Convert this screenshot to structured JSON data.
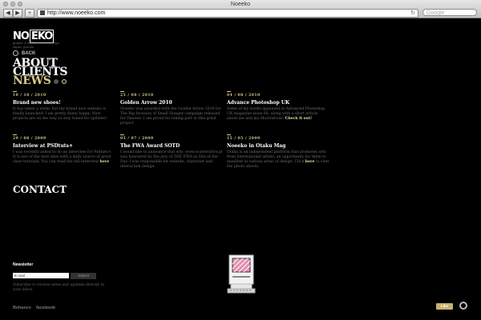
{
  "browser": {
    "window_title": "Noeeko",
    "url": "http://www.noeeko.com",
    "search_placeholder": "Google",
    "back_glyph": "◀",
    "forward_glyph": "▶",
    "add_glyph": "+",
    "reload_glyph": "↻"
  },
  "logo": {
    "text_a": "NO",
    "text_b": "EKO",
    "subtitle": "graphic & web interaction design studio, poznan"
  },
  "nav": {
    "back_label": "BACK",
    "about": "ABOUT",
    "clients": "CLIENTS",
    "news": "NEWS",
    "contact": "CONTACT"
  },
  "posts": [
    {
      "date": "10 / 10 / 2010",
      "title": "Brand new shoes!",
      "body": "It has taken a while, but my brand new website is finally launched! I am pretty damn happy. New projects are on the way so stay tuned for updates!",
      "link": ""
    },
    {
      "date": "25 / 08 / 2010",
      "title": "Golden Arrow 2010",
      "body": "Noeeko was awarded with the Golden Arrow 2010 for The Big Invasion of Small Hunger campaign released for Danone. I am proud for taking part in this great project.",
      "link": ""
    },
    {
      "date": "04 / 08 / 2010",
      "title": "Advance Photoshop UK",
      "body": "Some of my works appeared in Advanced Photoshop UK magazine issue 68, along with a short article about me and my illustrations.",
      "link": "Check it out!"
    },
    {
      "date": "29 / 08 / 2009",
      "title": "Interview at PSDtuts+",
      "body": "I was recently asked to do an interview for Psdtuts+. It is one of the best sites with a daily source of great class tutorials. You can read the full interview",
      "link": "here"
    },
    {
      "date": "05 / 07 / 2009",
      "title": "The FWA Award SOTD",
      "body": "I would like to announce that site, www.scatterative.pl was honoured by the jury of THE FWA as Site of the Day. I was responsible for website, character and interaction design.",
      "link": ""
    },
    {
      "date": "15 / 05 / 2009",
      "title": "Noeeko in Otaku Mag",
      "body": "Otaku is an independent platform that promotes arts from international artists, an opportunity for them to manifest in various areas of design. Click",
      "link": "here",
      "tail": "to view the photo shoots."
    }
  ],
  "newsletter": {
    "title": "Newsletter",
    "input_value": "E-mail",
    "submit_label": "Submit",
    "description": "Subscribe to receive news and updates directly in your inbox."
  },
  "social": {
    "behance": "Behance",
    "facebook": "facebook"
  },
  "widgets": {
    "like_label": "Like"
  },
  "colors": {
    "background": "#000000",
    "accent": "#d8c98a",
    "headline": "#ffffff"
  },
  "icons": [
    "back-ring-icon",
    "retro-computer-icon",
    "circle-ring-icon"
  ]
}
